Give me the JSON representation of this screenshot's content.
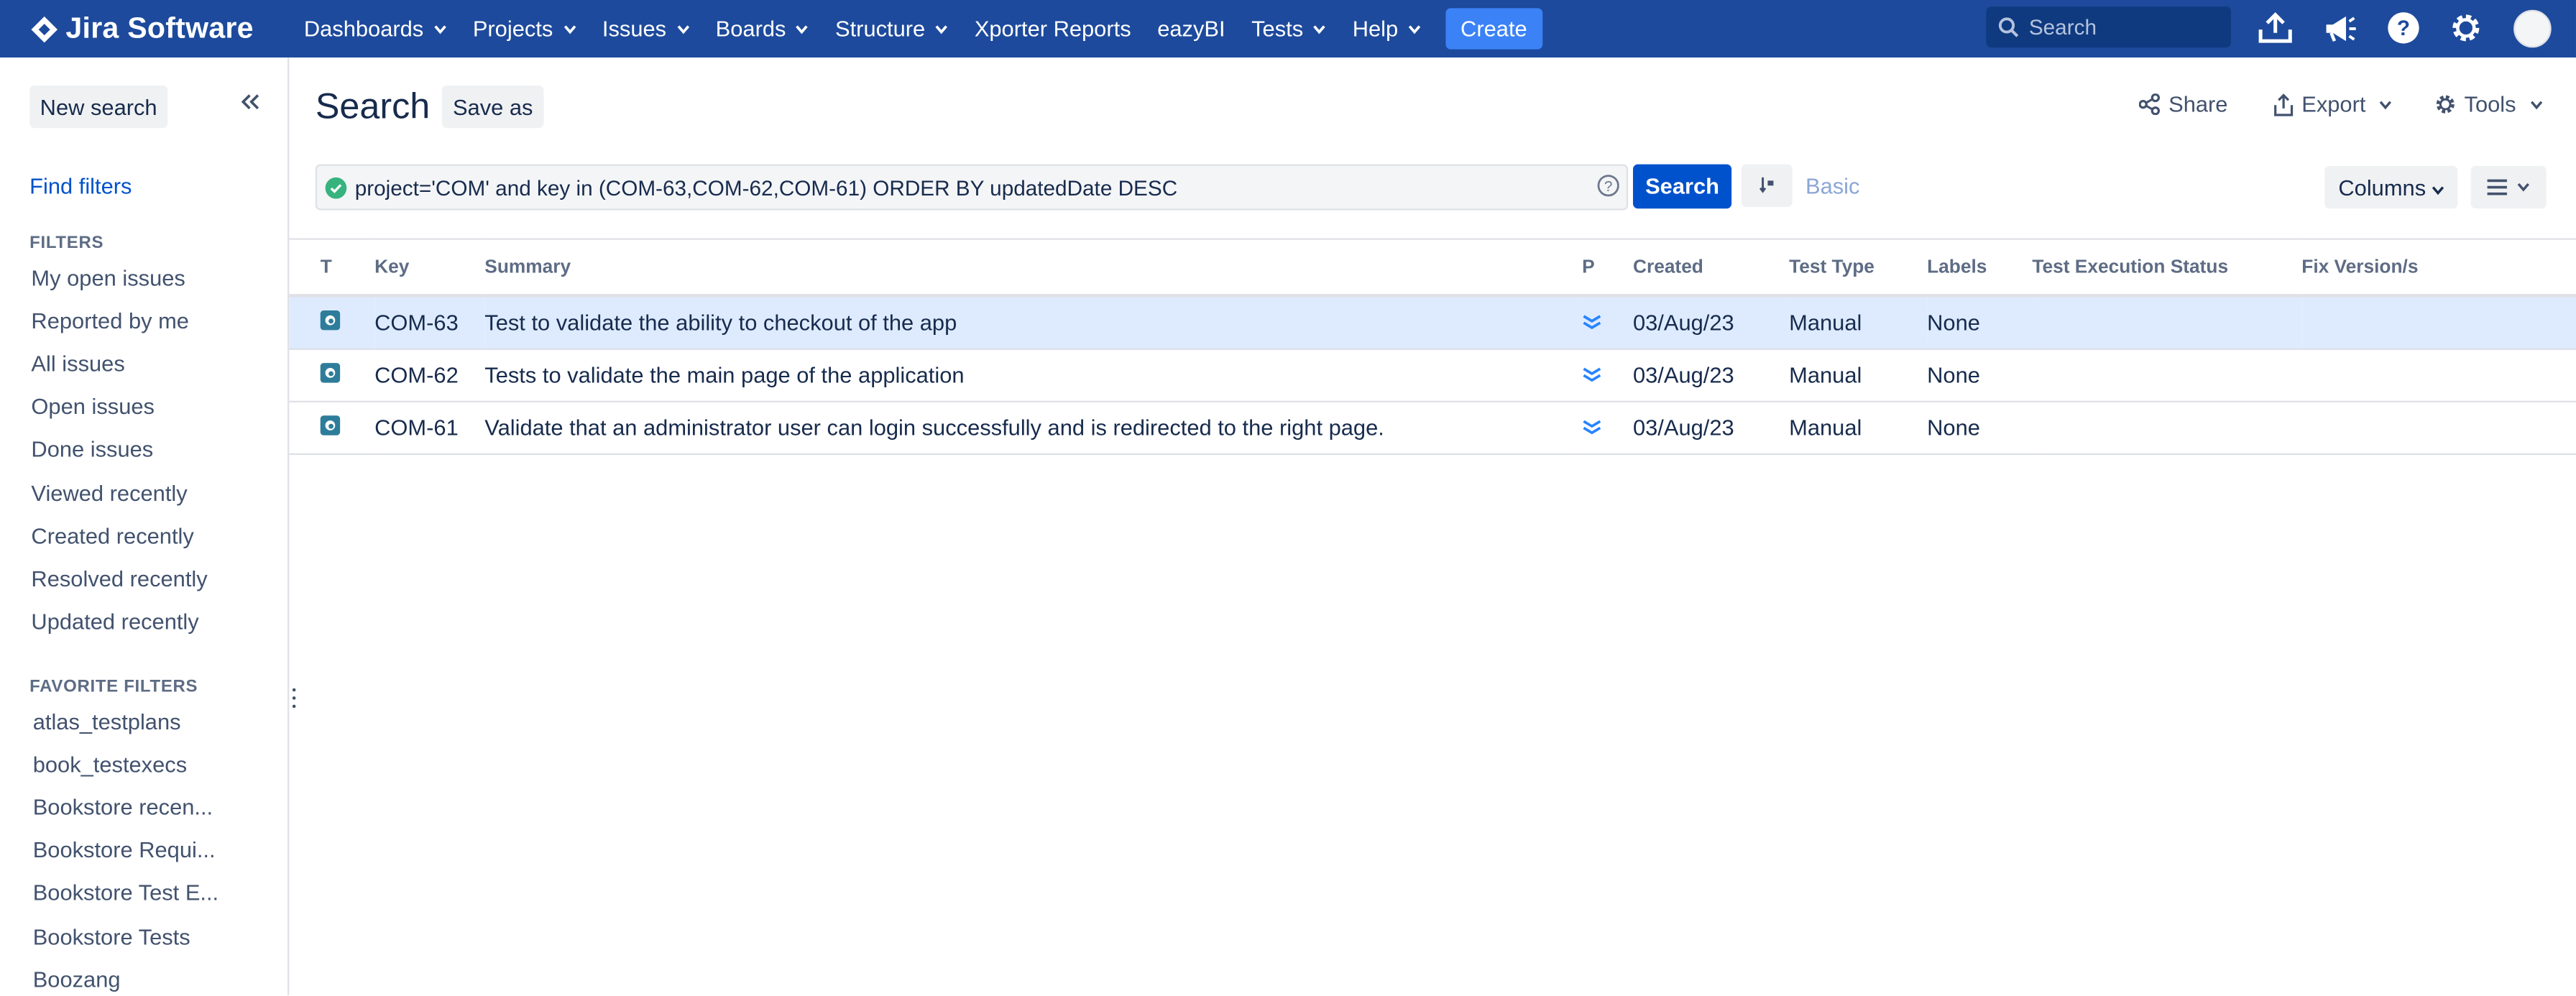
{
  "app": {
    "name": "Jira Software"
  },
  "nav": {
    "items": [
      {
        "label": "Dashboards",
        "dropdown": true
      },
      {
        "label": "Projects",
        "dropdown": true
      },
      {
        "label": "Issues",
        "dropdown": true
      },
      {
        "label": "Boards",
        "dropdown": true
      },
      {
        "label": "Structure",
        "dropdown": true
      },
      {
        "label": "Xporter Reports",
        "dropdown": false
      },
      {
        "label": "eazyBI",
        "dropdown": false
      },
      {
        "label": "Tests",
        "dropdown": true
      },
      {
        "label": "Help",
        "dropdown": true
      }
    ],
    "create_label": "Create",
    "search_placeholder": "Search"
  },
  "sidebar": {
    "new_search_label": "New search",
    "find_filters_label": "Find filters",
    "filters_heading": "FILTERS",
    "filters": [
      "My open issues",
      "Reported by me",
      "All issues",
      "Open issues",
      "Done issues",
      "Viewed recently",
      "Created recently",
      "Resolved recently",
      "Updated recently"
    ],
    "favorites_heading": "FAVORITE FILTERS",
    "favorites": [
      "atlas_testplans",
      "book_testexecs",
      "Bookstore recen...",
      "Bookstore Requi...",
      "Bookstore Test E...",
      "Bookstore Tests",
      "Boozang"
    ]
  },
  "header": {
    "title": "Search",
    "save_as_label": "Save as",
    "share_label": "Share",
    "export_label": "Export",
    "tools_label": "Tools"
  },
  "query": {
    "jql": "project='COM' and key in (COM-63,COM-62,COM-61) ORDER BY updatedDate DESC",
    "search_label": "Search",
    "basic_label": "Basic",
    "columns_label": "Columns"
  },
  "table": {
    "columns": [
      "T",
      "Key",
      "Summary",
      "P",
      "Created",
      "Test Type",
      "Labels",
      "Test Execution Status",
      "Fix Version/s"
    ],
    "rows": [
      {
        "key": "COM-63",
        "summary": "Test to validate the ability to checkout of the app",
        "created": "03/Aug/23",
        "test_type": "Manual",
        "labels": "None",
        "selected": true
      },
      {
        "key": "COM-62",
        "summary": "Tests to validate the main page of the application",
        "created": "03/Aug/23",
        "test_type": "Manual",
        "labels": "None",
        "selected": false
      },
      {
        "key": "COM-61",
        "summary": "Validate that an administrator user can login successfully and is redirected to the right page.",
        "created": "03/Aug/23",
        "test_type": "Manual",
        "labels": "None",
        "selected": false
      }
    ]
  },
  "colors": {
    "topbar": "#1d4a9c",
    "link": "#0052cc",
    "primary_button": "#0052cc",
    "create_button": "#3b82f6",
    "selected_row": "#deebff",
    "test_icon": "#2d7d9a",
    "priority_low": "#2684ff"
  },
  "icons": [
    "jira-logo-icon",
    "chevron-down-icon",
    "search-icon",
    "upload-icon",
    "megaphone-icon",
    "help-icon",
    "gear-icon",
    "avatar",
    "collapse-icon",
    "share-icon",
    "export-icon",
    "tools-icon",
    "check-circle-icon",
    "question-circle-icon",
    "switch-view-icon",
    "list-view-icon",
    "test-issue-icon",
    "priority-lowest-icon"
  ]
}
